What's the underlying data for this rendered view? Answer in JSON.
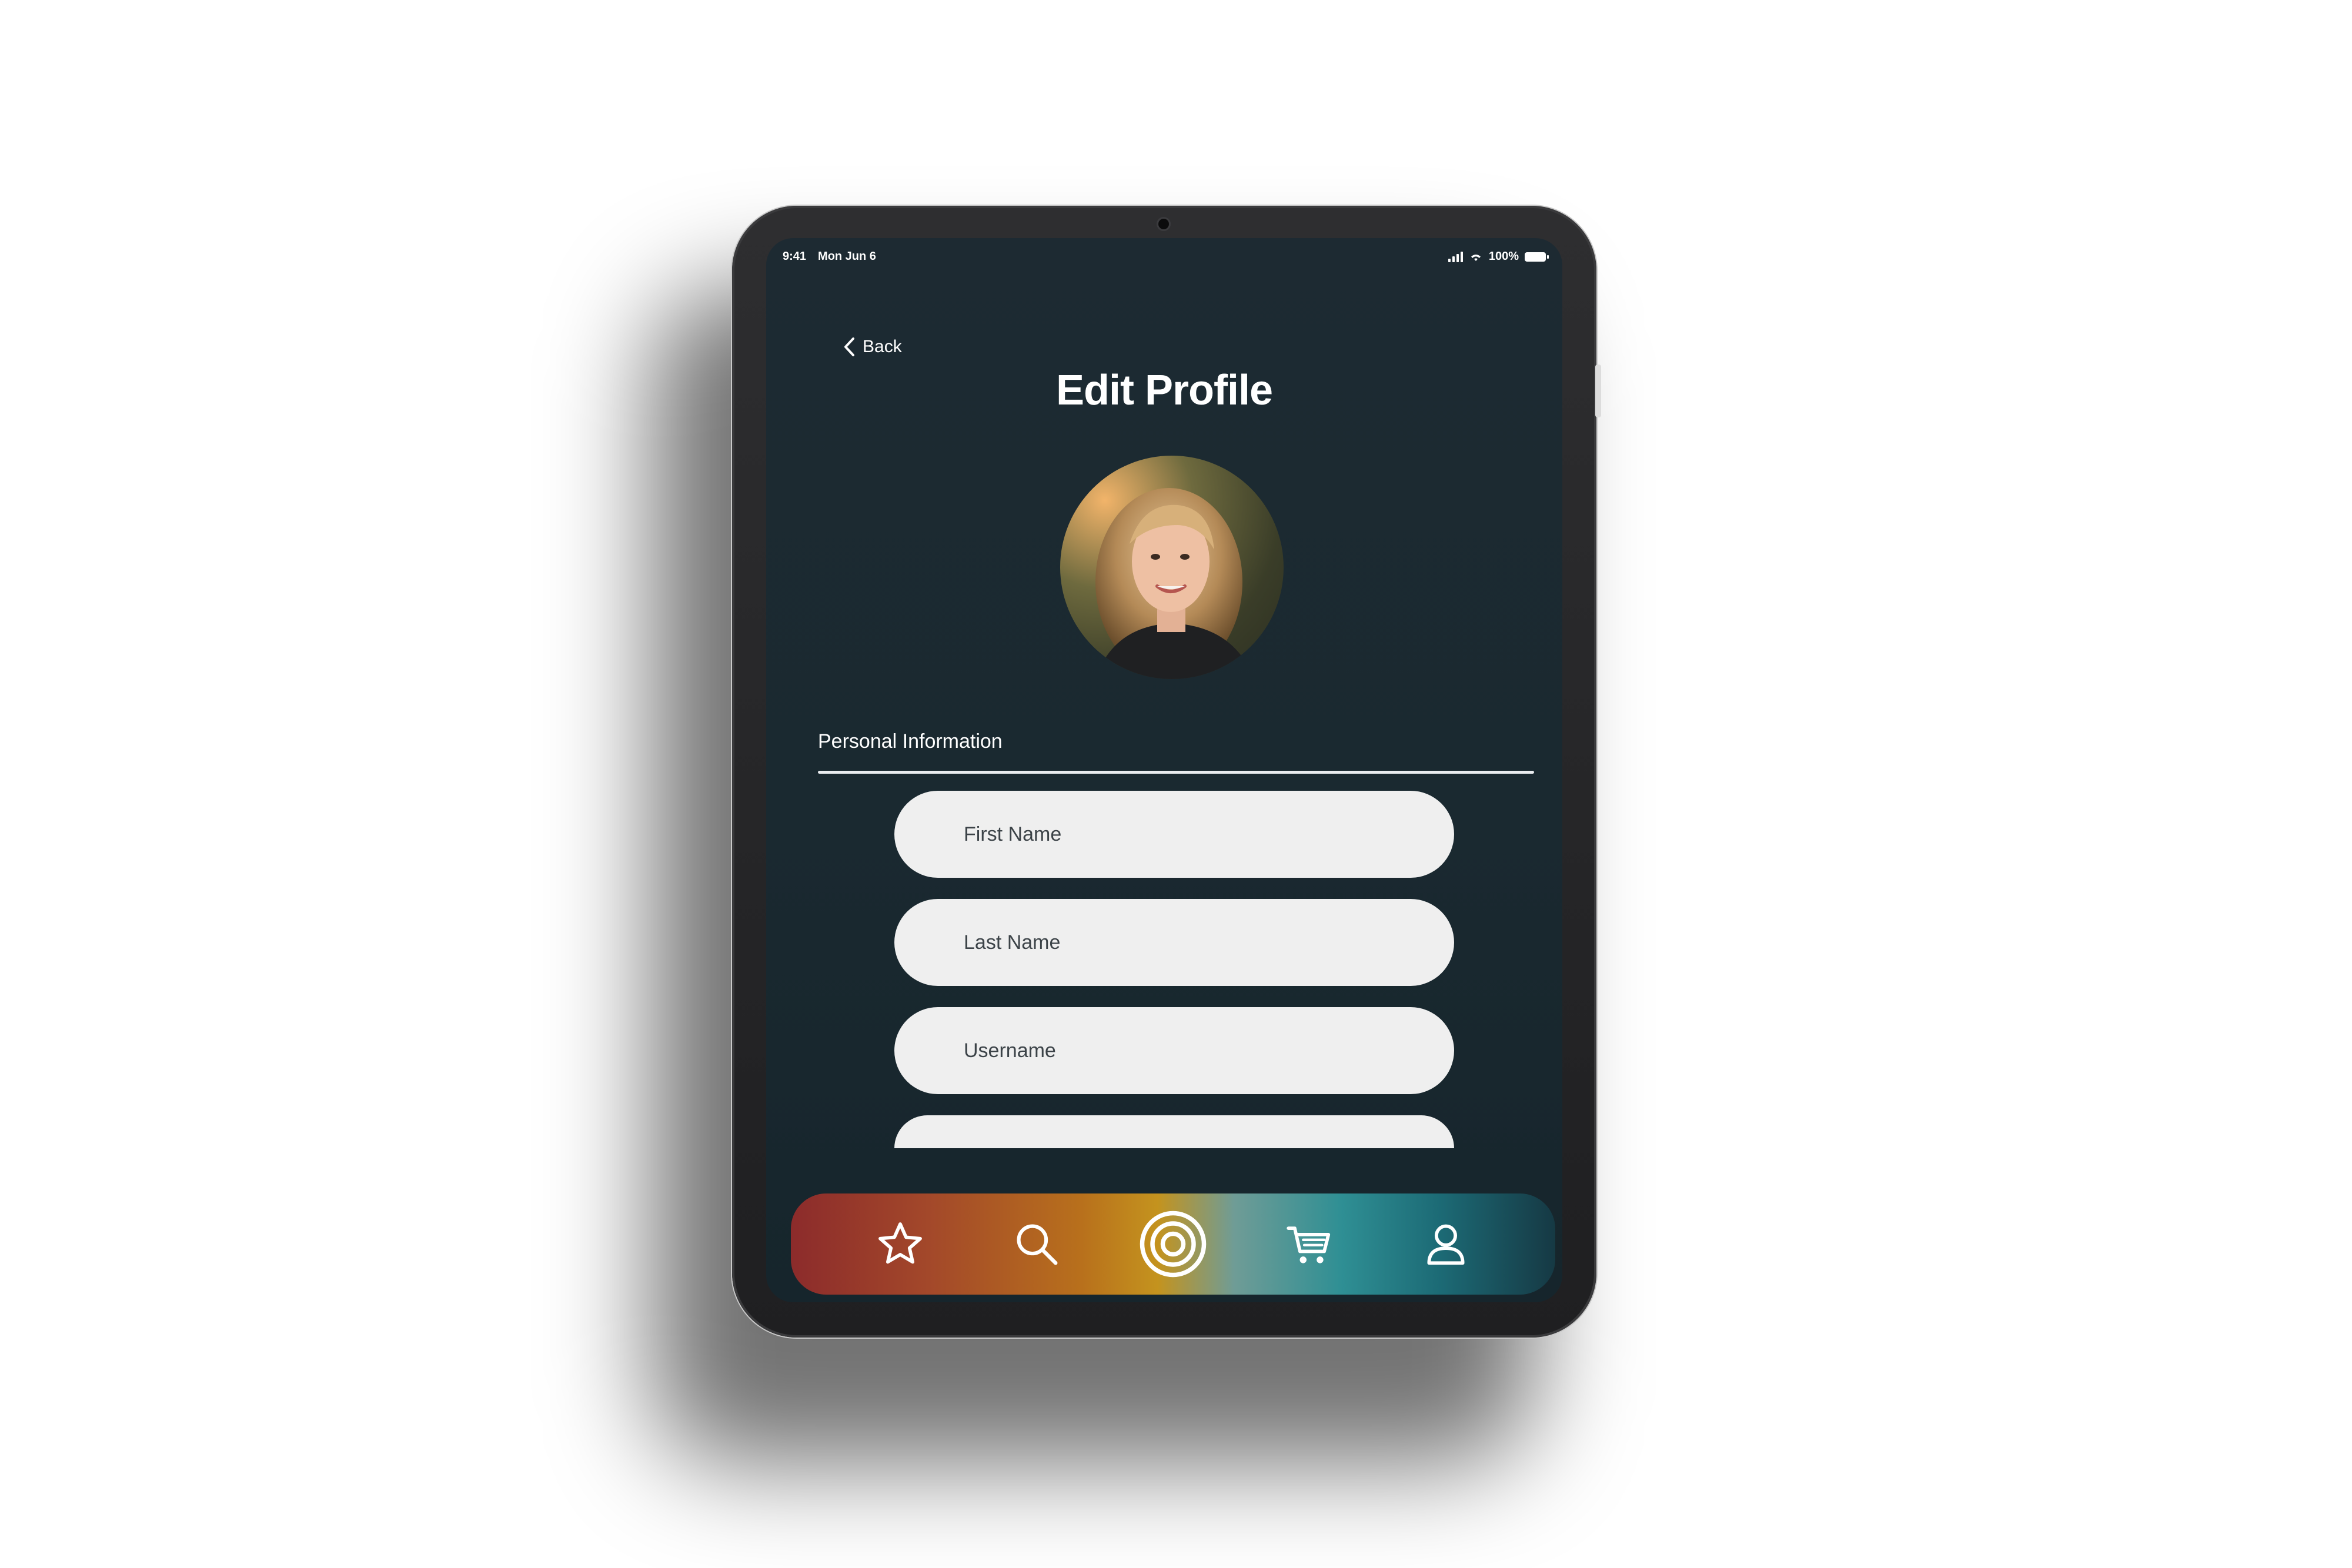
{
  "status_bar": {
    "time": "9:41",
    "date": "Mon Jun 6",
    "battery": "100%"
  },
  "nav": {
    "back_label": "Back"
  },
  "page": {
    "title": "Edit Profile"
  },
  "profile": {
    "section_label": "Personal Information"
  },
  "form": {
    "fields": [
      {
        "placeholder": "First Name"
      },
      {
        "placeholder": "Last Name"
      },
      {
        "placeholder": "Username"
      }
    ]
  },
  "tabbar": {
    "tabs": [
      {
        "icon": "star-icon"
      },
      {
        "icon": "search-icon"
      },
      {
        "icon": "target-icon"
      },
      {
        "icon": "cart-icon"
      },
      {
        "icon": "user-icon"
      }
    ]
  },
  "colors": {
    "screen_bg": "#1d2a32",
    "field_bg": "#efefef",
    "tab_gradient_start": "#8c2b2b",
    "tab_gradient_mid": "#c4931e",
    "tab_gradient_end": "#163944"
  }
}
